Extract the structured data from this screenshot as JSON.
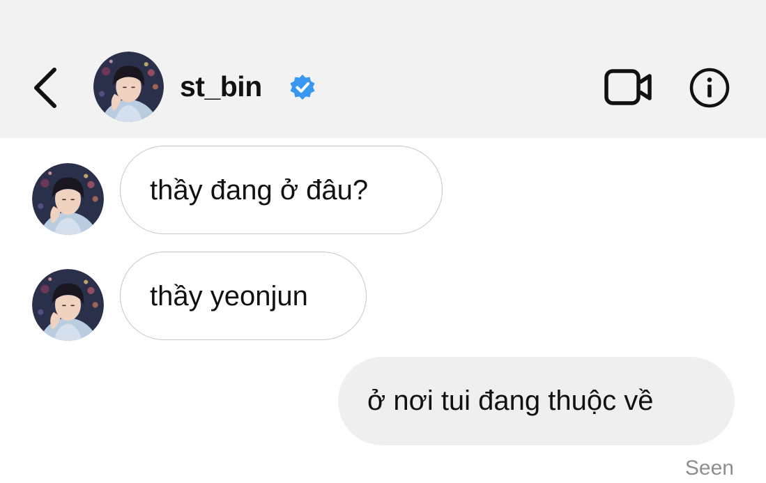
{
  "header": {
    "username": "st_bin",
    "verified": true,
    "background_color": "#f2f2f2",
    "icons": {
      "back": "chevron-left-icon",
      "verified": "verified-badge-icon",
      "video": "video-camera-icon",
      "info": "info-icon"
    }
  },
  "messages": [
    {
      "direction": "incoming",
      "text": "thầy đang ở đâu?"
    },
    {
      "direction": "incoming",
      "text": "thầy yeonjun"
    },
    {
      "direction": "outgoing",
      "text": "ở nơi tui đang thuộc về"
    }
  ],
  "status": {
    "seen_label": "Seen"
  },
  "colors": {
    "verified_blue": "#3897f0",
    "incoming_bubble_border": "#c4c4c4",
    "outgoing_bubble_bg": "#efefef",
    "seen_text": "#8e8e8e"
  }
}
